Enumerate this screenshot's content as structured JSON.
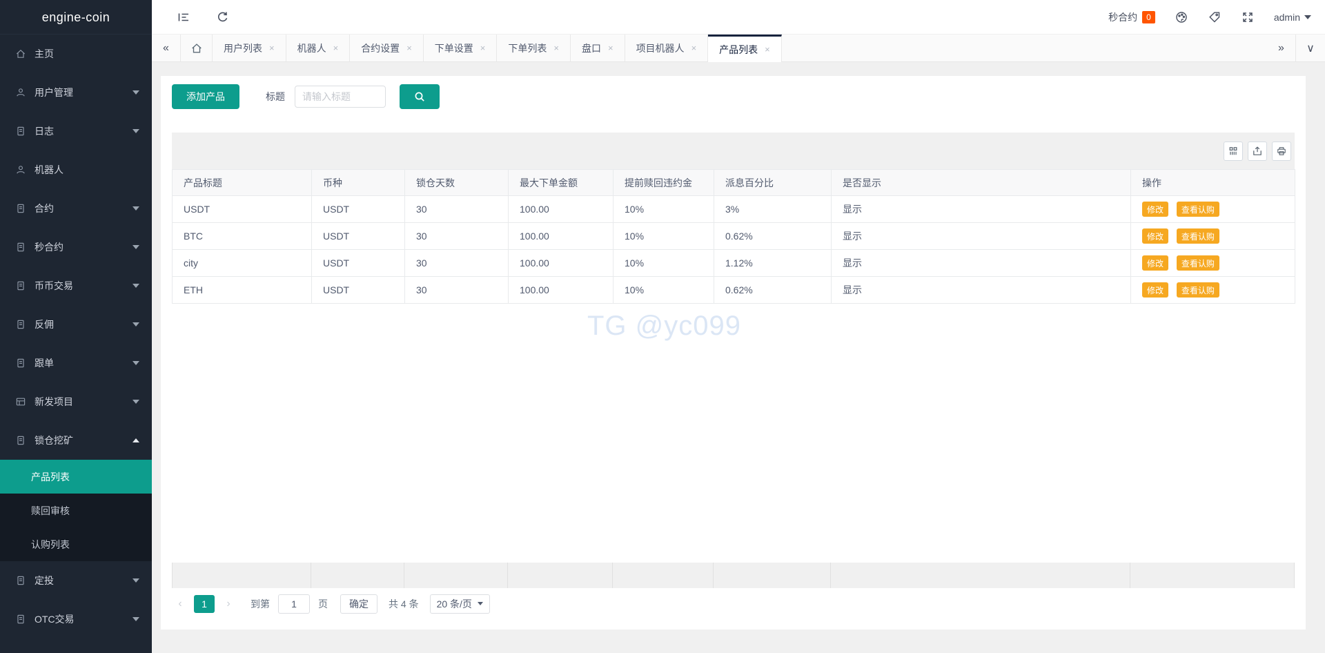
{
  "app": {
    "logo": "engine-coin"
  },
  "colors": {
    "accent": "#0d9d8d",
    "badge": "#ff5500",
    "action_button": "#f6a821",
    "sidebar_bg": "#1e2632",
    "active_tab_border": "#17233d"
  },
  "glyphs": {
    "close": "×",
    "double_left": "«",
    "double_right": "»",
    "chevron_down": "∨",
    "page_prev": "‹",
    "page_next": "›"
  },
  "header": {
    "module_label": "秒合约",
    "module_badge": "0",
    "user": "admin"
  },
  "sidebar": {
    "items": [
      {
        "label": "主页"
      },
      {
        "label": "用户管理"
      },
      {
        "label": "日志"
      },
      {
        "label": "机器人"
      },
      {
        "label": "合约"
      },
      {
        "label": "秒合约"
      },
      {
        "label": "币币交易"
      },
      {
        "label": "反佣"
      },
      {
        "label": "跟单"
      },
      {
        "label": "新发项目"
      },
      {
        "label": "锁仓挖矿"
      },
      {
        "label": "定投"
      },
      {
        "label": "OTC交易"
      }
    ],
    "submenu": {
      "items": [
        {
          "label": "产品列表"
        },
        {
          "label": "赎回审核"
        },
        {
          "label": "认购列表"
        }
      ],
      "active": "产品列表"
    }
  },
  "tabs": {
    "items": [
      {
        "label": "用户列表"
      },
      {
        "label": "机器人"
      },
      {
        "label": "合约设置"
      },
      {
        "label": "下单设置"
      },
      {
        "label": "下单列表"
      },
      {
        "label": "盘口"
      },
      {
        "label": "项目机器人"
      },
      {
        "label": "产品列表"
      }
    ],
    "active": "产品列表"
  },
  "toolbar": {
    "add_button": "添加产品",
    "filter_label": "标题",
    "search_placeholder": "请输入标题"
  },
  "table": {
    "headers": [
      "产品标题",
      "币种",
      "锁仓天数",
      "最大下单金额",
      "提前赎回违约金",
      "派息百分比",
      "是否显示",
      "操作"
    ],
    "actions": {
      "edit": "修改",
      "view": "查看认购"
    },
    "rows": [
      {
        "title": "USDT",
        "coin": "USDT",
        "days": "30",
        "max": "100.00",
        "penalty": "10%",
        "rate": "3%",
        "visible": "显示"
      },
      {
        "title": "BTC",
        "coin": "USDT",
        "days": "30",
        "max": "100.00",
        "penalty": "10%",
        "rate": "0.62%",
        "visible": "显示"
      },
      {
        "title": "city",
        "coin": "USDT",
        "days": "30",
        "max": "100.00",
        "penalty": "10%",
        "rate": "1.12%",
        "visible": "显示"
      },
      {
        "title": "ETH",
        "coin": "USDT",
        "days": "30",
        "max": "100.00",
        "penalty": "10%",
        "rate": "0.62%",
        "visible": "显示"
      }
    ]
  },
  "watermark": "TG @yc099",
  "pagination": {
    "page": "1",
    "goto_label": "到第",
    "page_value": "1",
    "page_unit": "页",
    "confirm": "确定",
    "total": "共 4 条",
    "per_page": "20 条/页"
  }
}
